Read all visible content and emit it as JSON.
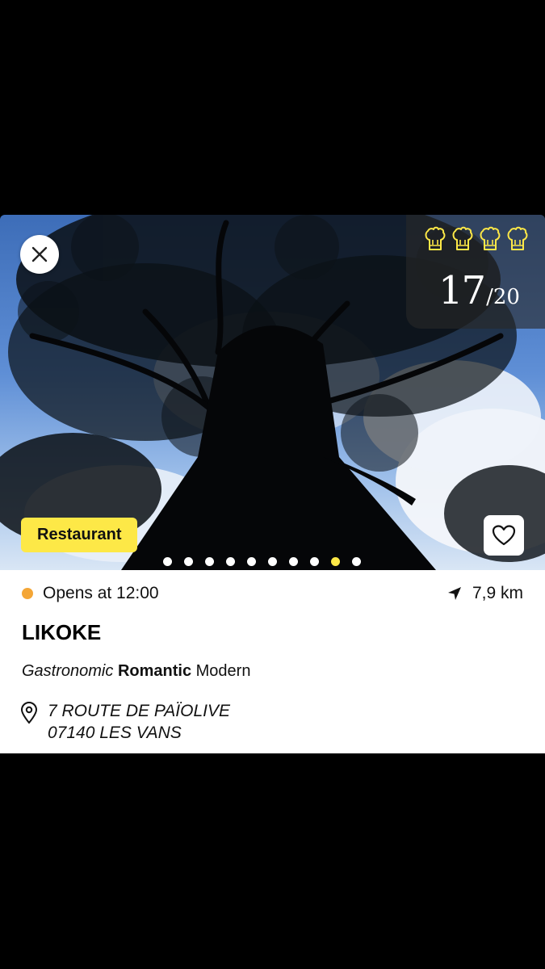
{
  "hero": {
    "score": "17",
    "score_max": "/20",
    "toque_count": 4,
    "category": "Restaurant",
    "photo_count": 10,
    "active_photo": 9
  },
  "restaurant": {
    "status": "Opens at 12:00",
    "distance": "7,9 km",
    "name": "LIKOKE",
    "tags": {
      "first": "Gastronomic",
      "second": "Romantic",
      "third": "Modern"
    },
    "address_line1": "7 ROUTE DE PAÏOLIVE",
    "address_line2": "07140 LES VANS"
  },
  "colors": {
    "accent_yellow": "#fde847",
    "status_orange": "#f4a636"
  },
  "icons": [
    "close-icon",
    "chef-hat-icon",
    "heart-icon",
    "navigation-arrow-icon",
    "map-pin-icon"
  ]
}
